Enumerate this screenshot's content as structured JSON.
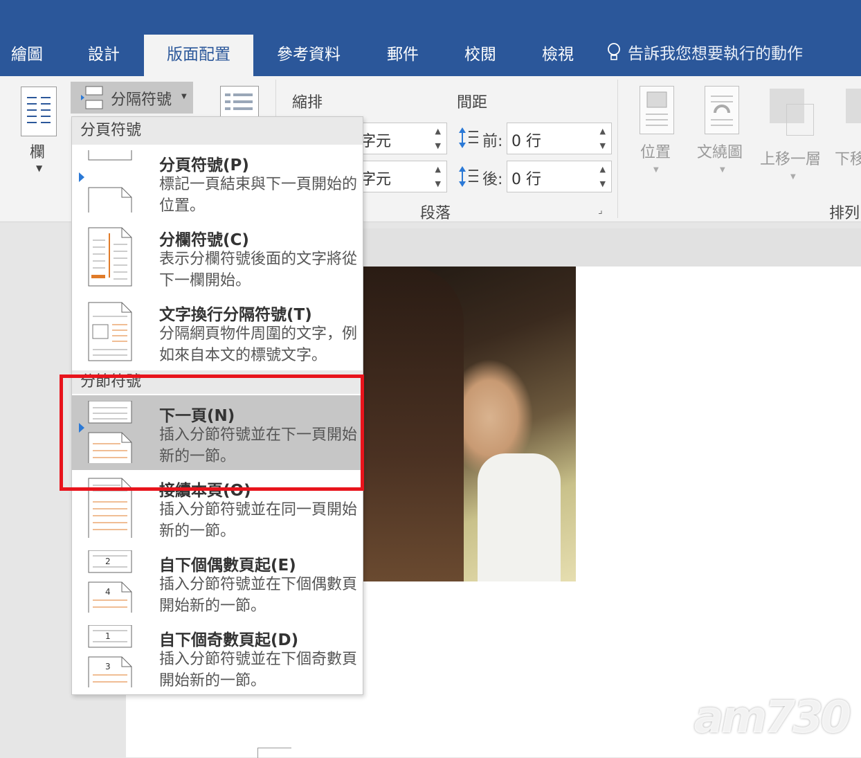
{
  "tabs": [
    {
      "label": "繪圖",
      "active": false
    },
    {
      "label": "設計",
      "active": false
    },
    {
      "label": "版面配置",
      "active": true
    },
    {
      "label": "參考資料",
      "active": false
    },
    {
      "label": "郵件",
      "active": false
    },
    {
      "label": "校閱",
      "active": false
    },
    {
      "label": "檢視",
      "active": false
    }
  ],
  "tell_me": "告訴我您想要執行的動作",
  "ribbon": {
    "columns_label": "欄",
    "breaks_label": "分隔符號",
    "indent_label": "縮排",
    "spacing_label": "間距",
    "indent_left_unit": "字元",
    "indent_right_unit": "字元",
    "before_label": "前:",
    "before_value": "0 行",
    "after_label": "後:",
    "after_value": "0 行",
    "paragraph_group": "段落",
    "position_label": "位置",
    "wrap_label": "文繞圖",
    "bring_forward_label": "上移一層",
    "send_backward_label": "下移",
    "arrange_group": "排列"
  },
  "menu": {
    "page_breaks_header": "分頁符號",
    "section_breaks_header": "分節符號",
    "items": [
      {
        "title": "分頁符號(P)",
        "desc": "標記一頁結束與下一頁開始的位置。"
      },
      {
        "title": "分欄符號(C)",
        "desc": "表示分欄符號後面的文字將從下一欄開始。"
      },
      {
        "title": "文字換行分隔符號(T)",
        "desc": "分隔網頁物件周圍的文字，例如來自本文的標號文字。"
      },
      {
        "title": "下一頁(N)",
        "desc": "插入分節符號並在下一頁開始新的一節。"
      },
      {
        "title": "接續本頁(O)",
        "desc": "插入分節符號並在同一頁開始新的一節。"
      },
      {
        "title": "自下個偶數頁起(E)",
        "desc": "插入分節符號並在下個偶數頁開始新的一節。"
      },
      {
        "title": "自下個奇數頁起(D)",
        "desc": "插入分節符號並在下個奇數頁開始新的一節。"
      }
    ],
    "icon_numbers": {
      "even_top": "2",
      "even_bottom": "4",
      "odd_top": "1",
      "odd_bottom": "3"
    }
  },
  "watermark": "am730",
  "colors": {
    "accent": "#2b579a",
    "highlight_box": "#e8141c"
  }
}
